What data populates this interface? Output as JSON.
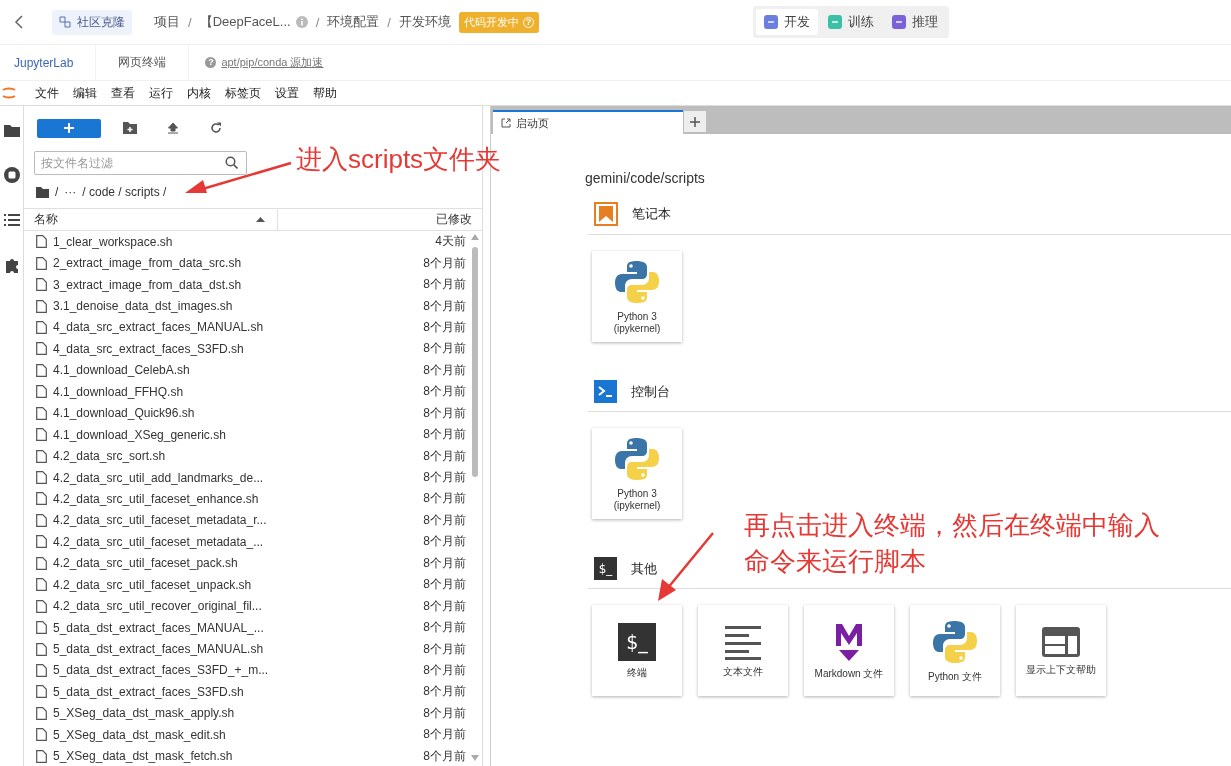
{
  "topbar": {
    "community_badge": "社区克隆",
    "breadcrumbs": [
      {
        "text": "项目",
        "info": false
      },
      {
        "text": "【DeepFaceL...",
        "info": true
      },
      {
        "text": "环境配置",
        "info": false
      },
      {
        "text": "开发环境",
        "info": false
      }
    ],
    "separator": "/",
    "status_tag": "代码开发中",
    "status_help": "?",
    "modes": [
      {
        "label": "开发",
        "selected": true,
        "color": "#6b7fe0"
      },
      {
        "label": "训练",
        "selected": false,
        "color": "#3cc0a8"
      },
      {
        "label": "推理",
        "selected": false,
        "color": "#7a62d8"
      }
    ]
  },
  "subtabs": [
    {
      "label": "JupyterLab",
      "selected": true
    },
    {
      "label": "网页终端",
      "selected": false
    }
  ],
  "mirror_help": "?",
  "mirror_link": "apt/pip/conda 源加速",
  "menu": [
    "文件",
    "编辑",
    "查看",
    "运行",
    "内核",
    "标签页",
    "设置",
    "帮助"
  ],
  "file_browser": {
    "filter_placeholder": "按文件名过滤",
    "path": [
      "/",
      "···",
      "/ code / scripts /"
    ],
    "columns": [
      "名称",
      "已修改"
    ],
    "rows": [
      {
        "name": "1_clear_workspace.sh",
        "modified": "4天前"
      },
      {
        "name": "2_extract_image_from_data_src.sh",
        "modified": "8个月前"
      },
      {
        "name": "3_extract_image_from_data_dst.sh",
        "modified": "8个月前"
      },
      {
        "name": "3.1_denoise_data_dst_images.sh",
        "modified": "8个月前"
      },
      {
        "name": "4_data_src_extract_faces_MANUAL.sh",
        "modified": "8个月前"
      },
      {
        "name": "4_data_src_extract_faces_S3FD.sh",
        "modified": "8个月前"
      },
      {
        "name": "4.1_download_CelebA.sh",
        "modified": "8个月前"
      },
      {
        "name": "4.1_download_FFHQ.sh",
        "modified": "8个月前"
      },
      {
        "name": "4.1_download_Quick96.sh",
        "modified": "8个月前"
      },
      {
        "name": "4.1_download_XSeg_generic.sh",
        "modified": "8个月前"
      },
      {
        "name": "4.2_data_src_sort.sh",
        "modified": "8个月前"
      },
      {
        "name": "4.2_data_src_util_add_landmarks_de...",
        "modified": "8个月前"
      },
      {
        "name": "4.2_data_src_util_faceset_enhance.sh",
        "modified": "8个月前"
      },
      {
        "name": "4.2_data_src_util_faceset_metadata_r...",
        "modified": "8个月前"
      },
      {
        "name": "4.2_data_src_util_faceset_metadata_...",
        "modified": "8个月前"
      },
      {
        "name": "4.2_data_src_util_faceset_pack.sh",
        "modified": "8个月前"
      },
      {
        "name": "4.2_data_src_util_faceset_unpack.sh",
        "modified": "8个月前"
      },
      {
        "name": "4.2_data_src_util_recover_original_fil...",
        "modified": "8个月前"
      },
      {
        "name": "5_data_dst_extract_faces_MANUAL_...",
        "modified": "8个月前"
      },
      {
        "name": "5_data_dst_extract_faces_MANUAL.sh",
        "modified": "8个月前"
      },
      {
        "name": "5_data_dst_extract_faces_S3FD_+_m...",
        "modified": "8个月前"
      },
      {
        "name": "5_data_dst_extract_faces_S3FD.sh",
        "modified": "8个月前"
      },
      {
        "name": "5_XSeg_data_dst_mask_apply.sh",
        "modified": "8个月前"
      },
      {
        "name": "5_XSeg_data_dst_mask_edit.sh",
        "modified": "8个月前"
      },
      {
        "name": "5_XSeg_data_dst_mask_fetch.sh",
        "modified": "8个月前"
      }
    ]
  },
  "launcher": {
    "tab": "启动页",
    "path": "gemini/code/scripts",
    "sections": [
      {
        "title": "笔记本",
        "kind": "notebook",
        "cards": [
          {
            "label": "Python 3\n(ipykernel)",
            "kind": "python"
          }
        ]
      },
      {
        "title": "控制台",
        "kind": "console",
        "cards": [
          {
            "label": "Python 3\n(ipykernel)",
            "kind": "python"
          }
        ]
      },
      {
        "title": "其他",
        "kind": "other",
        "glyph": "$_",
        "cards": [
          {
            "label": "终端",
            "kind": "terminal",
            "glyph": "$_"
          },
          {
            "label": "文本文件",
            "kind": "text"
          },
          {
            "label": "Markdown 文件",
            "kind": "markdown"
          },
          {
            "label": "Python 文件",
            "kind": "python"
          },
          {
            "label": "显示上下文帮助",
            "kind": "help"
          }
        ]
      }
    ]
  },
  "annotations": [
    {
      "lines": [
        "进入scripts文件夹"
      ],
      "kind": "folder-hint"
    },
    {
      "lines": [
        "再点击进入终端，然后在终端中输入",
        "命令来运行脚本"
      ],
      "kind": "terminal-hint"
    }
  ]
}
